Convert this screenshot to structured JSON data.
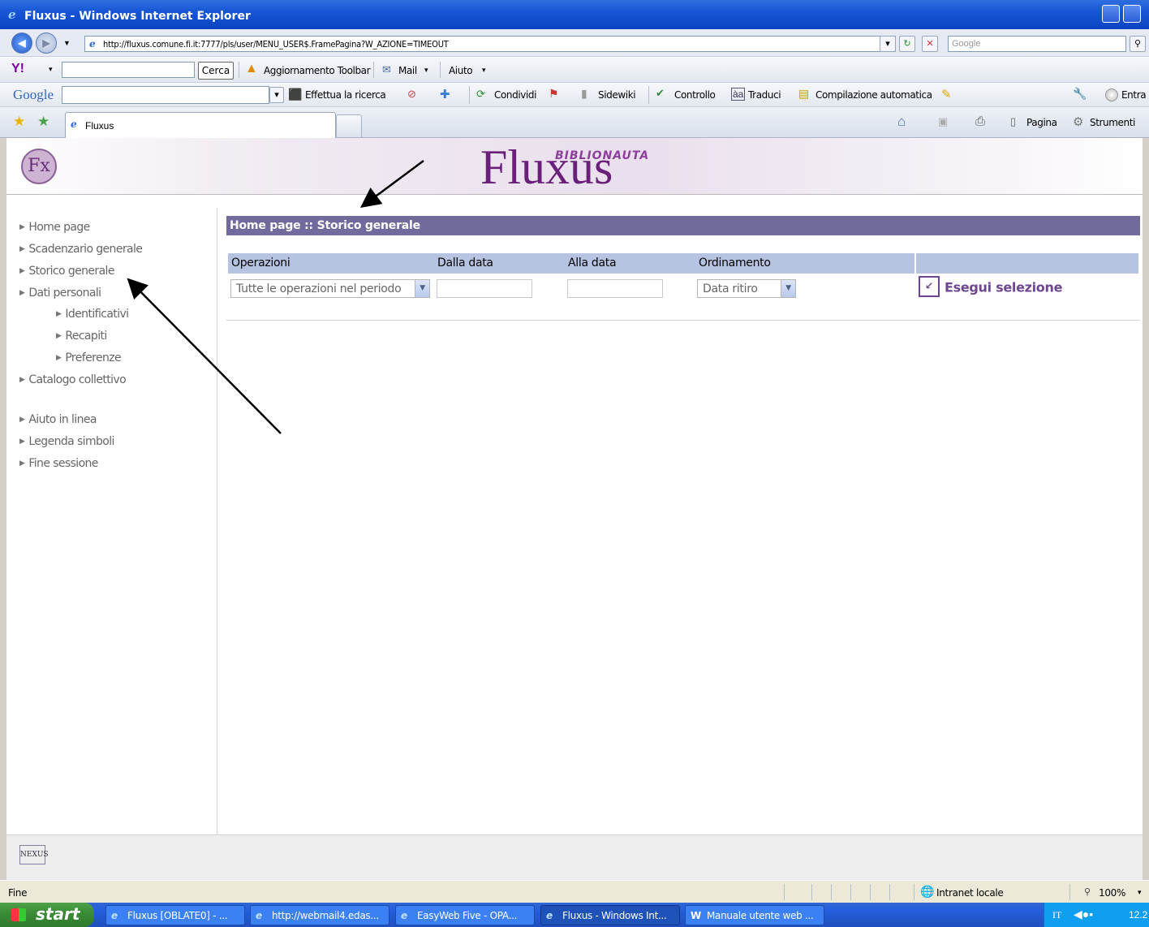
{
  "window": {
    "title": "Fluxus - Windows Internet Explorer"
  },
  "address": {
    "url": "http://fluxus.comune.fi.it:7777/pls/user/MENU_USER$.FramePagina?W_AZIONE=TIMEOUT",
    "search_placeholder": "Google"
  },
  "yahoo_toolbar": {
    "search_button": "Cerca",
    "update": "Aggiornamento Toolbar",
    "mail": "Mail",
    "help": "Aiuto"
  },
  "google_toolbar": {
    "logo": "Google",
    "search": "Effettua la ricerca",
    "share": "Condividi",
    "sidewiki": "Sidewiki",
    "check": "Controllo",
    "translate": "Traduci",
    "autofill": "Compilazione automatica",
    "signin": "Entra"
  },
  "tabs": {
    "active": "Fluxus",
    "page_menu": "Pagina",
    "tools_menu": "Strumenti"
  },
  "site": {
    "logo": "Fx",
    "brand": "Fluxus",
    "brand_sub": "BIBLIONAUTA"
  },
  "sidebar": {
    "items": [
      "Home page",
      "Scadenzario generale",
      "Storico generale",
      "Dati personali"
    ],
    "subitems": [
      "Identificativi",
      "Recapiti",
      "Preferenze"
    ],
    "catalog": "Catalogo collettivo",
    "bottom": [
      "Aiuto in linea",
      "Legenda simboli",
      "Fine sessione"
    ]
  },
  "breadcrumb": "Home page :: Storico generale",
  "form": {
    "headers": [
      "Operazioni",
      "Dalla data",
      "Alla data",
      "Ordinamento"
    ],
    "operazioni_value": "Tutte le operazioni nel periodo",
    "ordinamento_value": "Data ritiro",
    "execute": "Esegui selezione"
  },
  "footer": {
    "logo": "NEXUS"
  },
  "status": {
    "text": "Fine",
    "zone": "Intranet locale",
    "zoom": "100%"
  },
  "taskbar": {
    "start": "start",
    "tasks": [
      "Fluxus [OBLATE0] - ...",
      "http://webmail4.edas...",
      "EasyWeb Five - OPA...",
      "Fluxus - Windows Int...",
      "Manuale utente web ..."
    ],
    "lang": "IT",
    "clock": "12.2"
  }
}
